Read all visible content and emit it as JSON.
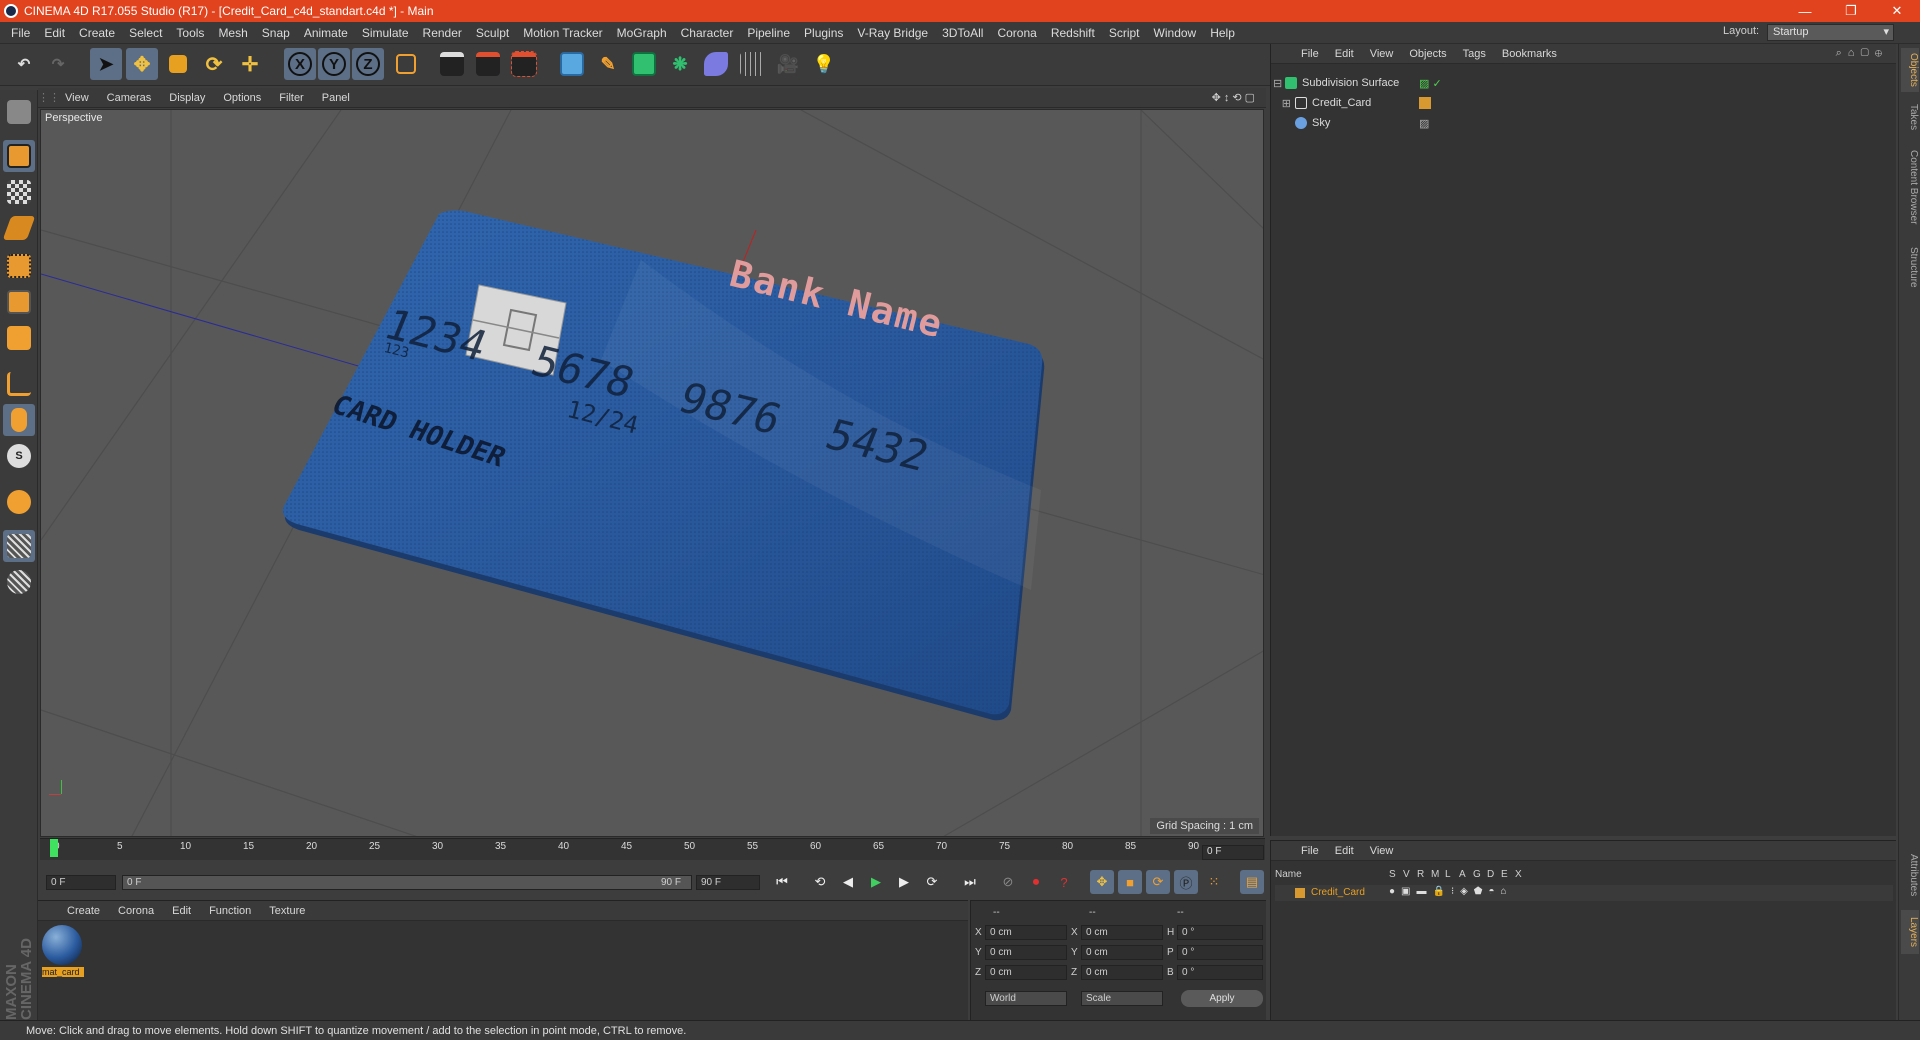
{
  "titlebar": {
    "title": "CINEMA 4D R17.055 Studio (R17) - [Credit_Card_c4d_standart.c4d *] - Main",
    "minimize": "—",
    "restore": "❐",
    "close": "✕"
  },
  "menubar": [
    "File",
    "Edit",
    "Create",
    "Select",
    "Tools",
    "Mesh",
    "Snap",
    "Animate",
    "Simulate",
    "Render",
    "Sculpt",
    "Motion Tracker",
    "MoGraph",
    "Character",
    "Pipeline",
    "Plugins",
    "V-Ray Bridge",
    "3DToAll",
    "Corona",
    "Redshift",
    "Script",
    "Window",
    "Help"
  ],
  "layout": {
    "label": "Layout:",
    "value": "Startup"
  },
  "viewport": {
    "menu": [
      "View",
      "Cameras",
      "Display",
      "Options",
      "Filter",
      "Panel"
    ],
    "camera_label": "Perspective",
    "grid_spacing": "Grid Spacing : 1 cm",
    "card": {
      "bank_name": "Bank Name",
      "number": "1234  5678  9876  5432",
      "small_number": "123",
      "expiry": "12/24",
      "holder": "CARD HOLDER",
      "card_color": "#2a5a9e",
      "bank_color": "#d99a9a"
    }
  },
  "object_manager": {
    "menu": [
      "File",
      "Edit",
      "View",
      "Objects",
      "Tags",
      "Bookmarks"
    ],
    "rows": [
      {
        "name": "Subdivision Surface",
        "icon": "subdivision-icon"
      },
      {
        "name": "Credit_Card",
        "icon": "null-object-icon"
      },
      {
        "name": "Sky",
        "icon": "sky-icon"
      }
    ]
  },
  "side_tabs": [
    "Objects",
    "Takes",
    "Content Browser",
    "Structure"
  ],
  "side_tabs_bottom": [
    "Attributes",
    "Layers"
  ],
  "timeline": {
    "ticks": [
      "0",
      "5",
      "10",
      "15",
      "20",
      "25",
      "30",
      "35",
      "40",
      "45",
      "50",
      "55",
      "60",
      "65",
      "70",
      "75",
      "80",
      "85",
      "90"
    ],
    "current_frame": "0 F",
    "start": "0 F",
    "range_start": "0 F",
    "range_end": "90 F",
    "end": "90 F"
  },
  "material_manager": {
    "menu": [
      "Create",
      "Corona",
      "Edit",
      "Function",
      "Texture"
    ],
    "material_name": "mat_card"
  },
  "coordinates": {
    "headers": [
      "--",
      "--",
      "--"
    ],
    "rows": [
      {
        "axis": "X",
        "pos": "0 cm",
        "axis2": "X",
        "size": "0 cm",
        "rot_axis": "H",
        "rot": "0 °"
      },
      {
        "axis": "Y",
        "pos": "0 cm",
        "axis2": "Y",
        "size": "0 cm",
        "rot_axis": "P",
        "rot": "0 °"
      },
      {
        "axis": "Z",
        "pos": "0 cm",
        "axis2": "Z",
        "size": "0 cm",
        "rot_axis": "B",
        "rot": "0 °"
      }
    ],
    "mode1": "World",
    "mode2": "Scale",
    "apply": "Apply"
  },
  "layer_manager": {
    "menu": [
      "File",
      "Edit",
      "View"
    ],
    "columns": [
      "Name",
      "S",
      "V",
      "R",
      "M",
      "L",
      "A",
      "G",
      "D",
      "E",
      "X"
    ],
    "row_name": "Credit_Card"
  },
  "statusbar": "Move: Click and drag to move elements. Hold down SHIFT to quantize movement / add to the selection in point mode, CTRL to remove.",
  "maxon_logo": "MAXON CINEMA 4D"
}
